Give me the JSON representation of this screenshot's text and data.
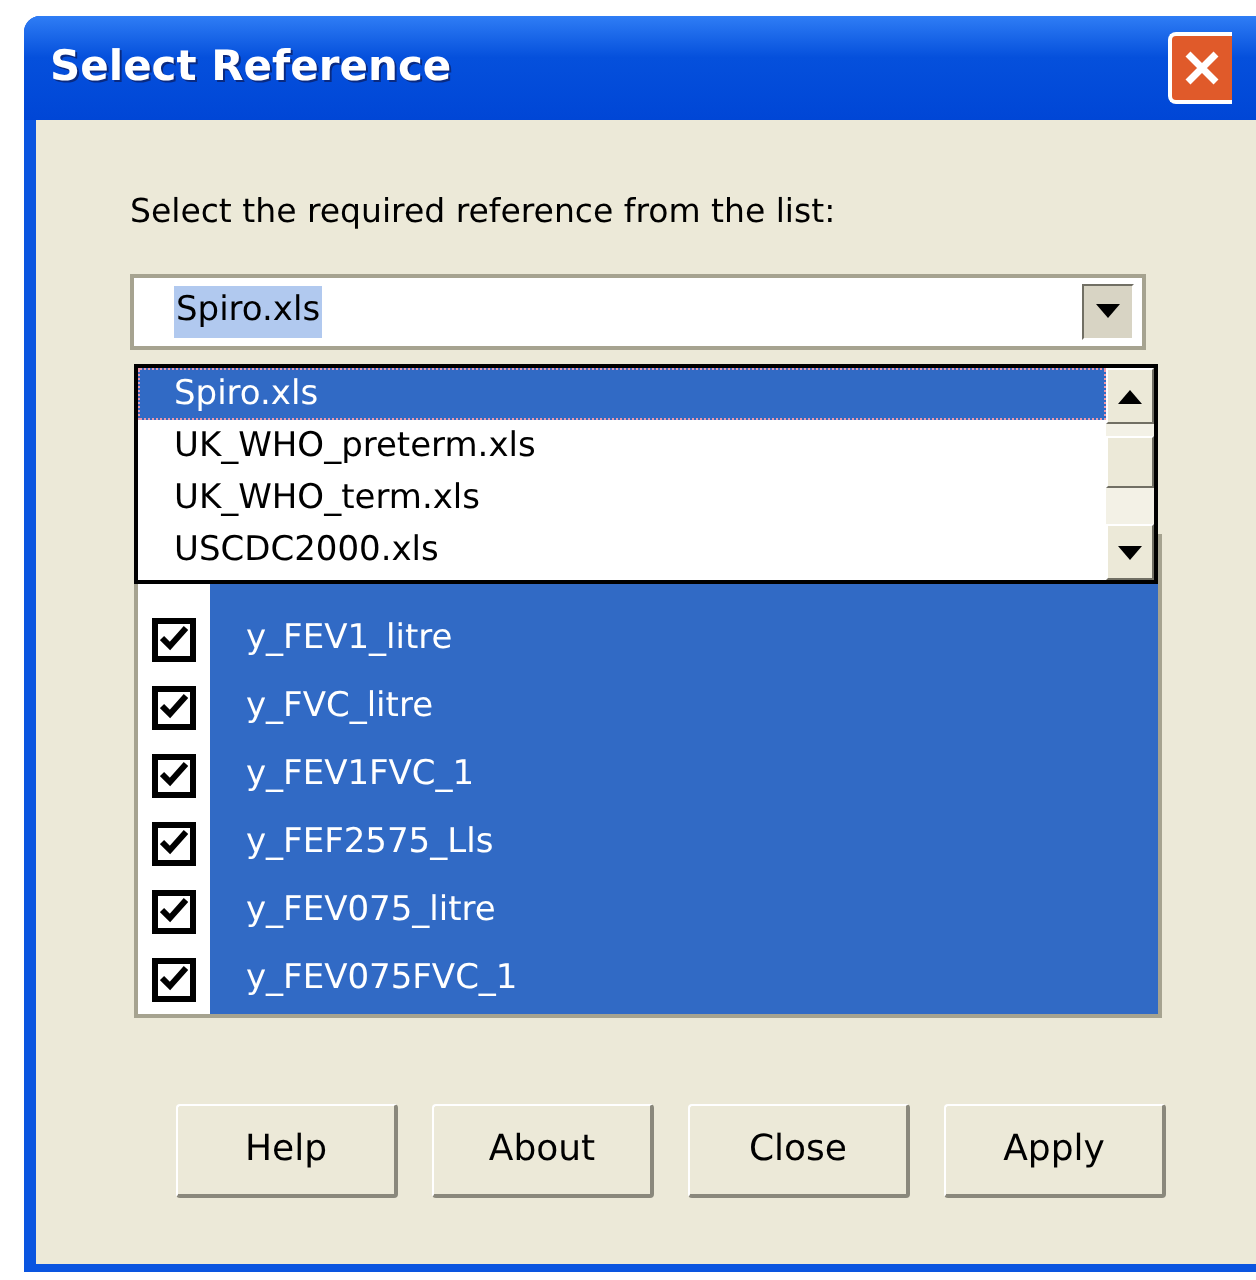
{
  "window": {
    "title": "Select Reference"
  },
  "prompt": "Select the required reference from the list:",
  "reference_combo": {
    "value": "Spiro.xls",
    "expanded": true
  },
  "dropdown_items": [
    {
      "label": "Spiro.xls",
      "selected": true
    },
    {
      "label": "UK_WHO_preterm.xls",
      "selected": false
    },
    {
      "label": "UK_WHO_term.xls",
      "selected": false
    },
    {
      "label": "USCDC2000.xls",
      "selected": false
    }
  ],
  "variables": [
    {
      "label": "y_FEV1_litre",
      "checked": true,
      "selected": true
    },
    {
      "label": "y_FVC_litre",
      "checked": true,
      "selected": true
    },
    {
      "label": "y_FEV1FVC_1",
      "checked": true,
      "selected": true
    },
    {
      "label": "y_FEF2575_Lls",
      "checked": true,
      "selected": true
    },
    {
      "label": "y_FEV075_litre",
      "checked": true,
      "selected": true
    },
    {
      "label": "y_FEV075FVC_1",
      "checked": true,
      "selected": true
    }
  ],
  "buttons": [
    "Help",
    "About",
    "Close",
    "Apply"
  ]
}
